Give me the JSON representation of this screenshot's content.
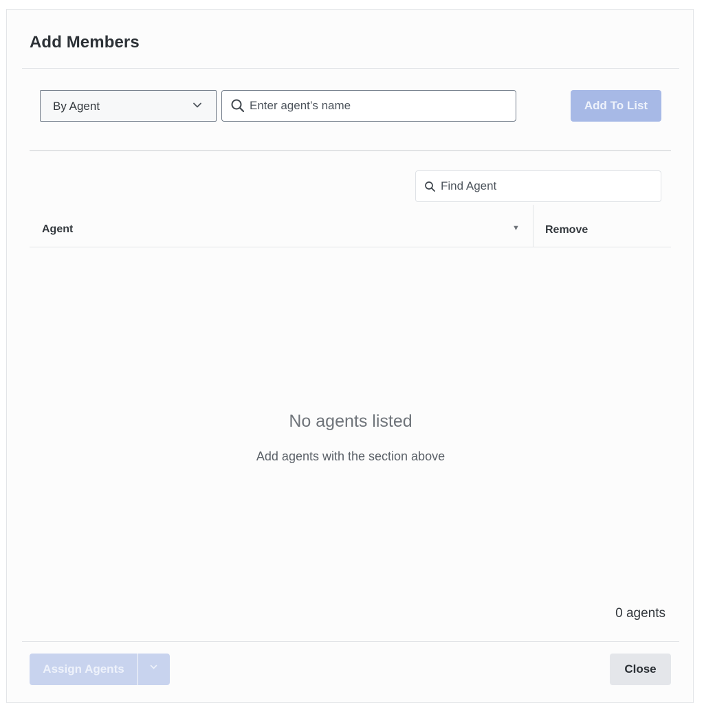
{
  "modal": {
    "title": "Add Members"
  },
  "add_row": {
    "filter_select": {
      "selected": "By Agent",
      "icon": "chevron-down-icon"
    },
    "agent_search": {
      "placeholder": "Enter agent’s name",
      "value": "",
      "icon": "search-icon"
    },
    "add_to_list_label": "Add To List"
  },
  "find_agent": {
    "placeholder": "Find Agent",
    "value": "",
    "icon": "search-icon"
  },
  "table": {
    "columns": [
      {
        "label": "Agent",
        "sortable": true,
        "sort_icon": "sort-down-icon"
      },
      {
        "label": "Remove",
        "sortable": false
      }
    ],
    "rows": []
  },
  "empty_state": {
    "title": "No agents listed",
    "subtitle": "Add agents with the section above"
  },
  "agent_count": "0 agents",
  "footer": {
    "assign_label": "Assign Agents",
    "assign_menu_icon": "chevron-down-icon",
    "close_label": "Close"
  },
  "colors": {
    "primary_disabled": "#a7b9e6",
    "assign_disabled": "#c8d3ee",
    "secondary_button": "#e4e6ea",
    "border": "#6f7a87"
  }
}
